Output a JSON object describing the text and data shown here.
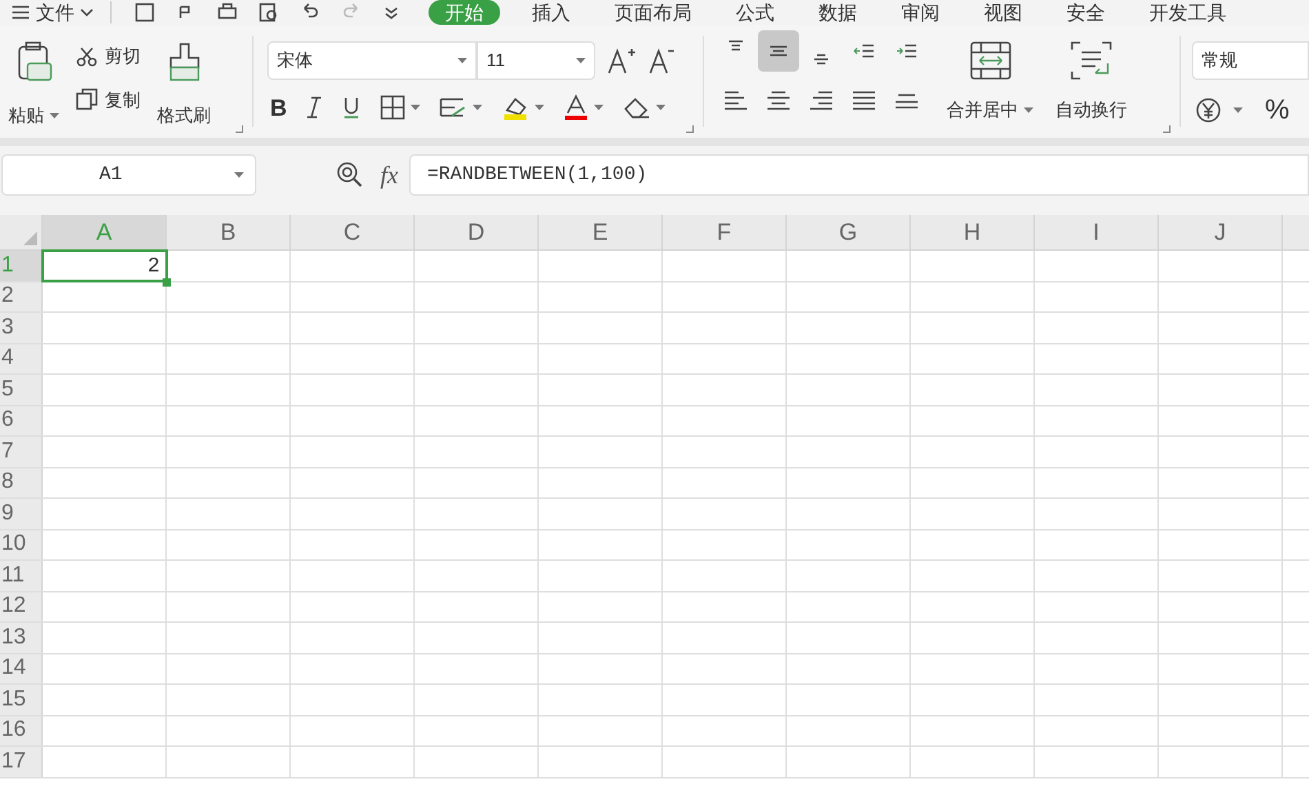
{
  "menu": {
    "label": "文件"
  },
  "ribbon_tabs": [
    {
      "label": "开始",
      "selected": true
    },
    {
      "label": "插入",
      "selected": false
    },
    {
      "label": "页面布局",
      "selected": false
    },
    {
      "label": "公式",
      "selected": false
    },
    {
      "label": "数据",
      "selected": false
    },
    {
      "label": "审阅",
      "selected": false
    },
    {
      "label": "视图",
      "selected": false
    },
    {
      "label": "安全",
      "selected": false
    },
    {
      "label": "开发工具",
      "selected": false
    }
  ],
  "clipboard": {
    "paste": "粘贴",
    "cut": "剪切",
    "copy": "复制",
    "format_painter": "格式刷"
  },
  "font": {
    "name": "宋体",
    "size": "11",
    "bold": "B"
  },
  "alignment_buttons": [
    {
      "kind": "top",
      "selected": false
    },
    {
      "kind": "middle",
      "selected": true
    },
    {
      "kind": "bottom",
      "selected": false
    },
    {
      "kind": "outdent",
      "selected": false
    },
    {
      "kind": "indent",
      "selected": false
    }
  ],
  "merge": "合并居中",
  "wrap": "自动换行",
  "number_format": {
    "value": "常规",
    "percent": "%"
  },
  "name_box": "A1",
  "fx": "fx",
  "formula": "=RANDBETWEEN(1,100)",
  "columns": [
    {
      "label": "A",
      "selected": true
    },
    {
      "label": "B",
      "selected": false
    },
    {
      "label": "C",
      "selected": false
    },
    {
      "label": "D",
      "selected": false
    },
    {
      "label": "E",
      "selected": false
    },
    {
      "label": "F",
      "selected": false
    },
    {
      "label": "G",
      "selected": false
    },
    {
      "label": "H",
      "selected": false
    },
    {
      "label": "I",
      "selected": false
    },
    {
      "label": "J",
      "selected": false
    }
  ],
  "rows": [
    {
      "label": "1",
      "selected": true,
      "cells": [
        {
          "value": "2",
          "active": true
        }
      ]
    },
    {
      "label": "2",
      "selected": false
    },
    {
      "label": "3",
      "selected": false
    },
    {
      "label": "4",
      "selected": false
    },
    {
      "label": "5",
      "selected": false
    },
    {
      "label": "6",
      "selected": false
    },
    {
      "label": "7",
      "selected": false
    },
    {
      "label": "8",
      "selected": false
    },
    {
      "label": "9",
      "selected": false
    },
    {
      "label": "10",
      "selected": false
    },
    {
      "label": "11",
      "selected": false
    },
    {
      "label": "12",
      "selected": false
    },
    {
      "label": "13",
      "selected": false
    },
    {
      "label": "14",
      "selected": false
    },
    {
      "label": "15",
      "selected": false
    },
    {
      "label": "16",
      "selected": false
    },
    {
      "label": "17",
      "selected": false
    }
  ]
}
